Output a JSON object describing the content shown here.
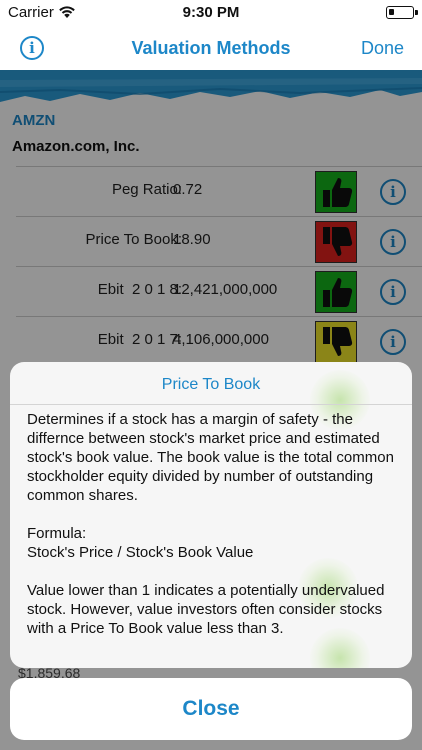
{
  "status_bar": {
    "carrier": "Carrier",
    "time": "9:30 PM"
  },
  "nav": {
    "title": "Valuation Methods",
    "done_label": "Done",
    "info_icon": "info-icon"
  },
  "stock": {
    "ticker": "AMZN",
    "company": "Amazon.com, Inc."
  },
  "metrics": [
    {
      "label": "Peg Ratio:",
      "value": "0.72",
      "rating": "thumbs-up",
      "color": "#16b11c"
    },
    {
      "label": "Price To Book:",
      "value": "18.90",
      "rating": "thumbs-down",
      "color": "#e0221e"
    },
    {
      "label": "Ebit  2 0 1 8:",
      "value": "12,421,000,000",
      "rating": "thumbs-up",
      "color": "#16b11c"
    },
    {
      "label": "Ebit  2 0 1 7:",
      "value": "4,106,000,000",
      "rating": "thumbs-down",
      "color": "#f0e62a"
    }
  ],
  "background_price": "$1,859.68",
  "modal": {
    "title": "Price To Book",
    "paragraph1": "Determines if a stock has a margin of safety - the differnce between stock's market price and estimated stock's book value. The book value is the total common stockholder equity divided by number of outstanding common shares.",
    "formula_label": "Formula:",
    "formula": "Stock's Price / Stock's Book Value",
    "paragraph3": "Value lower than 1 indicates a potentially undervalued stock. However, value investors often consider stocks with a Price To Book value less than 3."
  },
  "close_label": "Close",
  "colors": {
    "accent": "#1d87c8",
    "good": "#16b11c",
    "bad": "#e0221e",
    "warn": "#f0e62a"
  }
}
